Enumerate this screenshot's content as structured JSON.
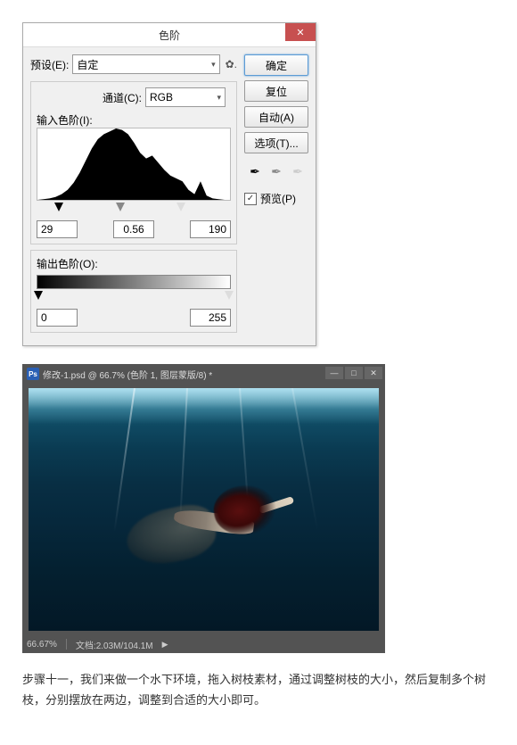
{
  "dialog": {
    "title": "色阶",
    "preset_label": "预设(E):",
    "preset_value": "自定",
    "channel_label": "通道(C):",
    "channel_value": "RGB",
    "input_levels_label": "输入色阶(I):",
    "shadows": "29",
    "midtones": "0.56",
    "highlights": "190",
    "output_levels_label": "输出色阶(O):",
    "output_low": "0",
    "output_high": "255",
    "buttons": {
      "ok": "确定",
      "cancel": "复位",
      "auto": "自动(A)",
      "options": "选项(T)..."
    },
    "preview_label": "预览(P)"
  },
  "ps": {
    "doc_title": "修改-1.psd @ 66.7% (色阶 1, 图层蒙版/8) *",
    "zoom": "66.67%",
    "doc_size": "文档:2.03M/104.1M"
  },
  "caption": "步骤十一，我们来做一个水下环境，拖入树枝素材，通过调整树枝的大小，然后复制多个树枝，分别摆放在两边，调整到合适的大小即可。",
  "chart_data": {
    "type": "area",
    "title": "",
    "xlabel": "",
    "ylabel": "",
    "xlim": [
      0,
      255
    ],
    "ylim": [
      0,
      100
    ],
    "sliders": {
      "black": 29,
      "gray_gamma": 0.56,
      "white": 190
    },
    "x": [
      0,
      8,
      16,
      24,
      32,
      40,
      48,
      56,
      64,
      72,
      80,
      88,
      96,
      104,
      112,
      120,
      128,
      136,
      144,
      152,
      160,
      168,
      176,
      184,
      192,
      200,
      208,
      216,
      224,
      232,
      240,
      248,
      255
    ],
    "values": [
      0,
      1,
      2,
      4,
      8,
      14,
      24,
      38,
      55,
      72,
      85,
      92,
      96,
      100,
      98,
      92,
      80,
      66,
      58,
      62,
      52,
      42,
      34,
      30,
      26,
      14,
      8,
      26,
      6,
      2,
      1,
      0,
      0
    ]
  }
}
